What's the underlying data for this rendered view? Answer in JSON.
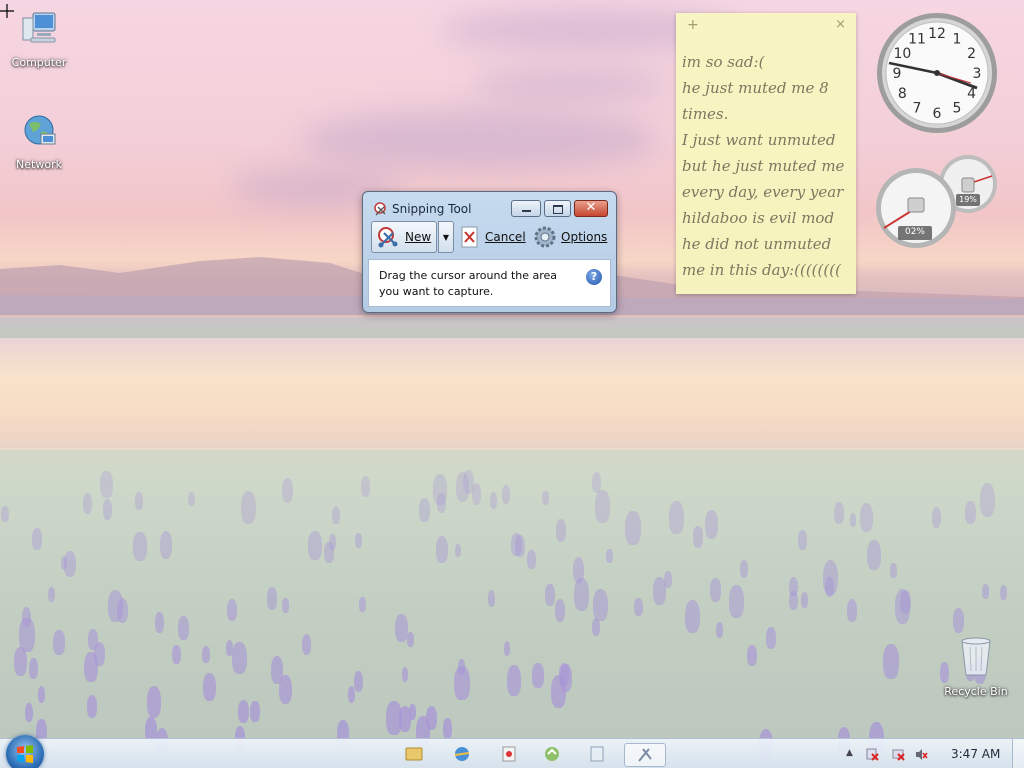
{
  "desktop": {
    "icons": [
      {
        "label": "Computer",
        "icon": "computer-icon"
      },
      {
        "label": "Network",
        "icon": "network-icon"
      },
      {
        "label": "Recycle Bin",
        "icon": "recycle-bin-icon"
      }
    ]
  },
  "snipping_tool": {
    "title": "Snipping Tool",
    "new_label": "New",
    "cancel_label": "Cancel",
    "options_label": "Options",
    "message": "Drag the cursor around the area you want to capture.",
    "help": "?"
  },
  "sticky_note": {
    "add": "+",
    "close": "×",
    "lines": [
      "im so sad:(",
      "he just muted me 8",
      "times.",
      "I just want unmuted",
      "but he just muted me",
      "every day, every year",
      "hildaboo is evil mod",
      "he did not unmuted",
      "me in this day:(((((((("
    ]
  },
  "clock": {
    "numerals": [
      "12",
      "1",
      "2",
      "3",
      "4",
      "5",
      "6",
      "7",
      "8",
      "9",
      "10",
      "11"
    ]
  },
  "cpu_meter": {
    "cpu": "02%",
    "memory": "19%"
  },
  "taskbar": {
    "time": "3:47 AM",
    "apps": [
      "explorer-icon",
      "internet-explorer-icon",
      "media-player-icon",
      "windows-update-icon",
      "sticky-notes-icon",
      "snipping-tool-icon"
    ]
  }
}
